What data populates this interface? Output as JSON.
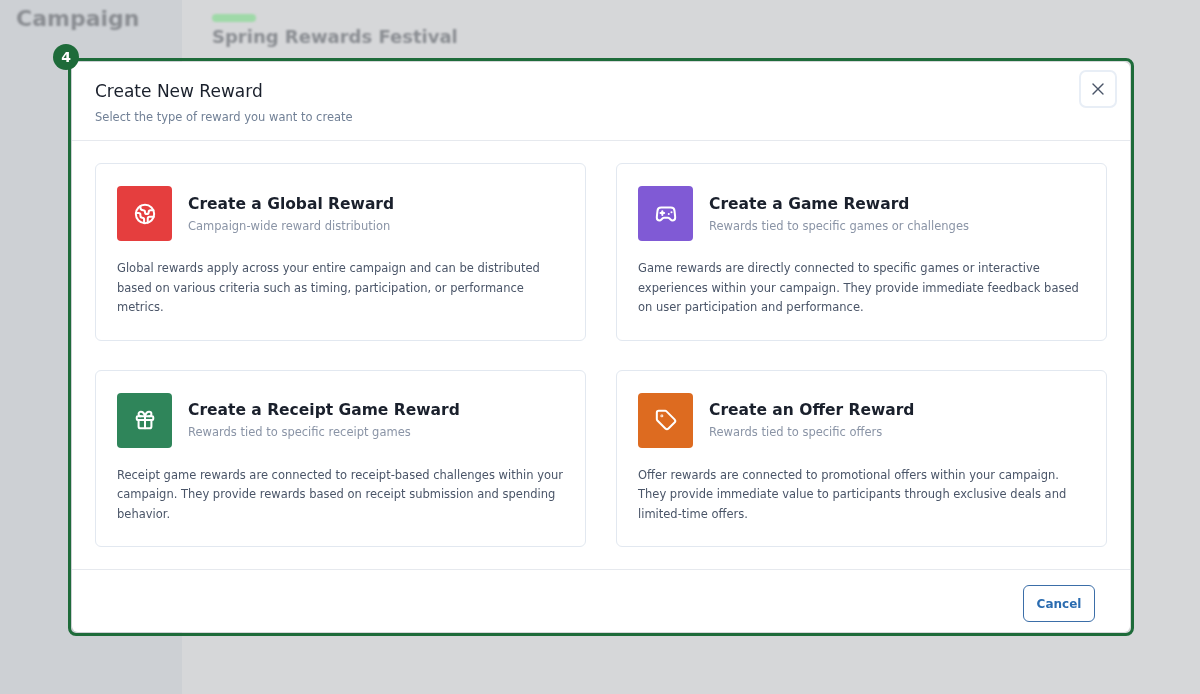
{
  "background": {
    "app_title": "Campaign",
    "campaign_name": "Spring Rewards Festival"
  },
  "annotation": {
    "badge": "4"
  },
  "dialog": {
    "title": "Create New Reward",
    "subtitle": "Select the type of reward you want to create",
    "options": [
      {
        "kind": "global",
        "color": "#e53e3e",
        "title": "Create a Global Reward",
        "subtitle": "Campaign-wide reward distribution",
        "description": "Global rewards apply across your entire campaign and can be distributed based on various criteria such as timing, participation, or performance metrics."
      },
      {
        "kind": "game",
        "color": "#805ad5",
        "title": "Create a Game Reward",
        "subtitle": "Rewards tied to specific games or challenges",
        "description": "Game rewards are directly connected to specific games or interactive experiences within your campaign. They provide immediate feedback based on user participation and performance."
      },
      {
        "kind": "receipt",
        "color": "#2f855a",
        "title": "Create a Receipt Game Reward",
        "subtitle": "Rewards tied to specific receipt games",
        "description": "Receipt game rewards are connected to receipt-based challenges within your campaign. They provide rewards based on receipt submission and spending behavior."
      },
      {
        "kind": "offer",
        "color": "#dd6b20",
        "title": "Create an Offer Reward",
        "subtitle": "Rewards tied to specific offers",
        "description": "Offer rewards are connected to promotional offers within your campaign. They provide immediate value to participants through exclusive deals and limited-time offers."
      }
    ],
    "cancel": "Cancel"
  }
}
